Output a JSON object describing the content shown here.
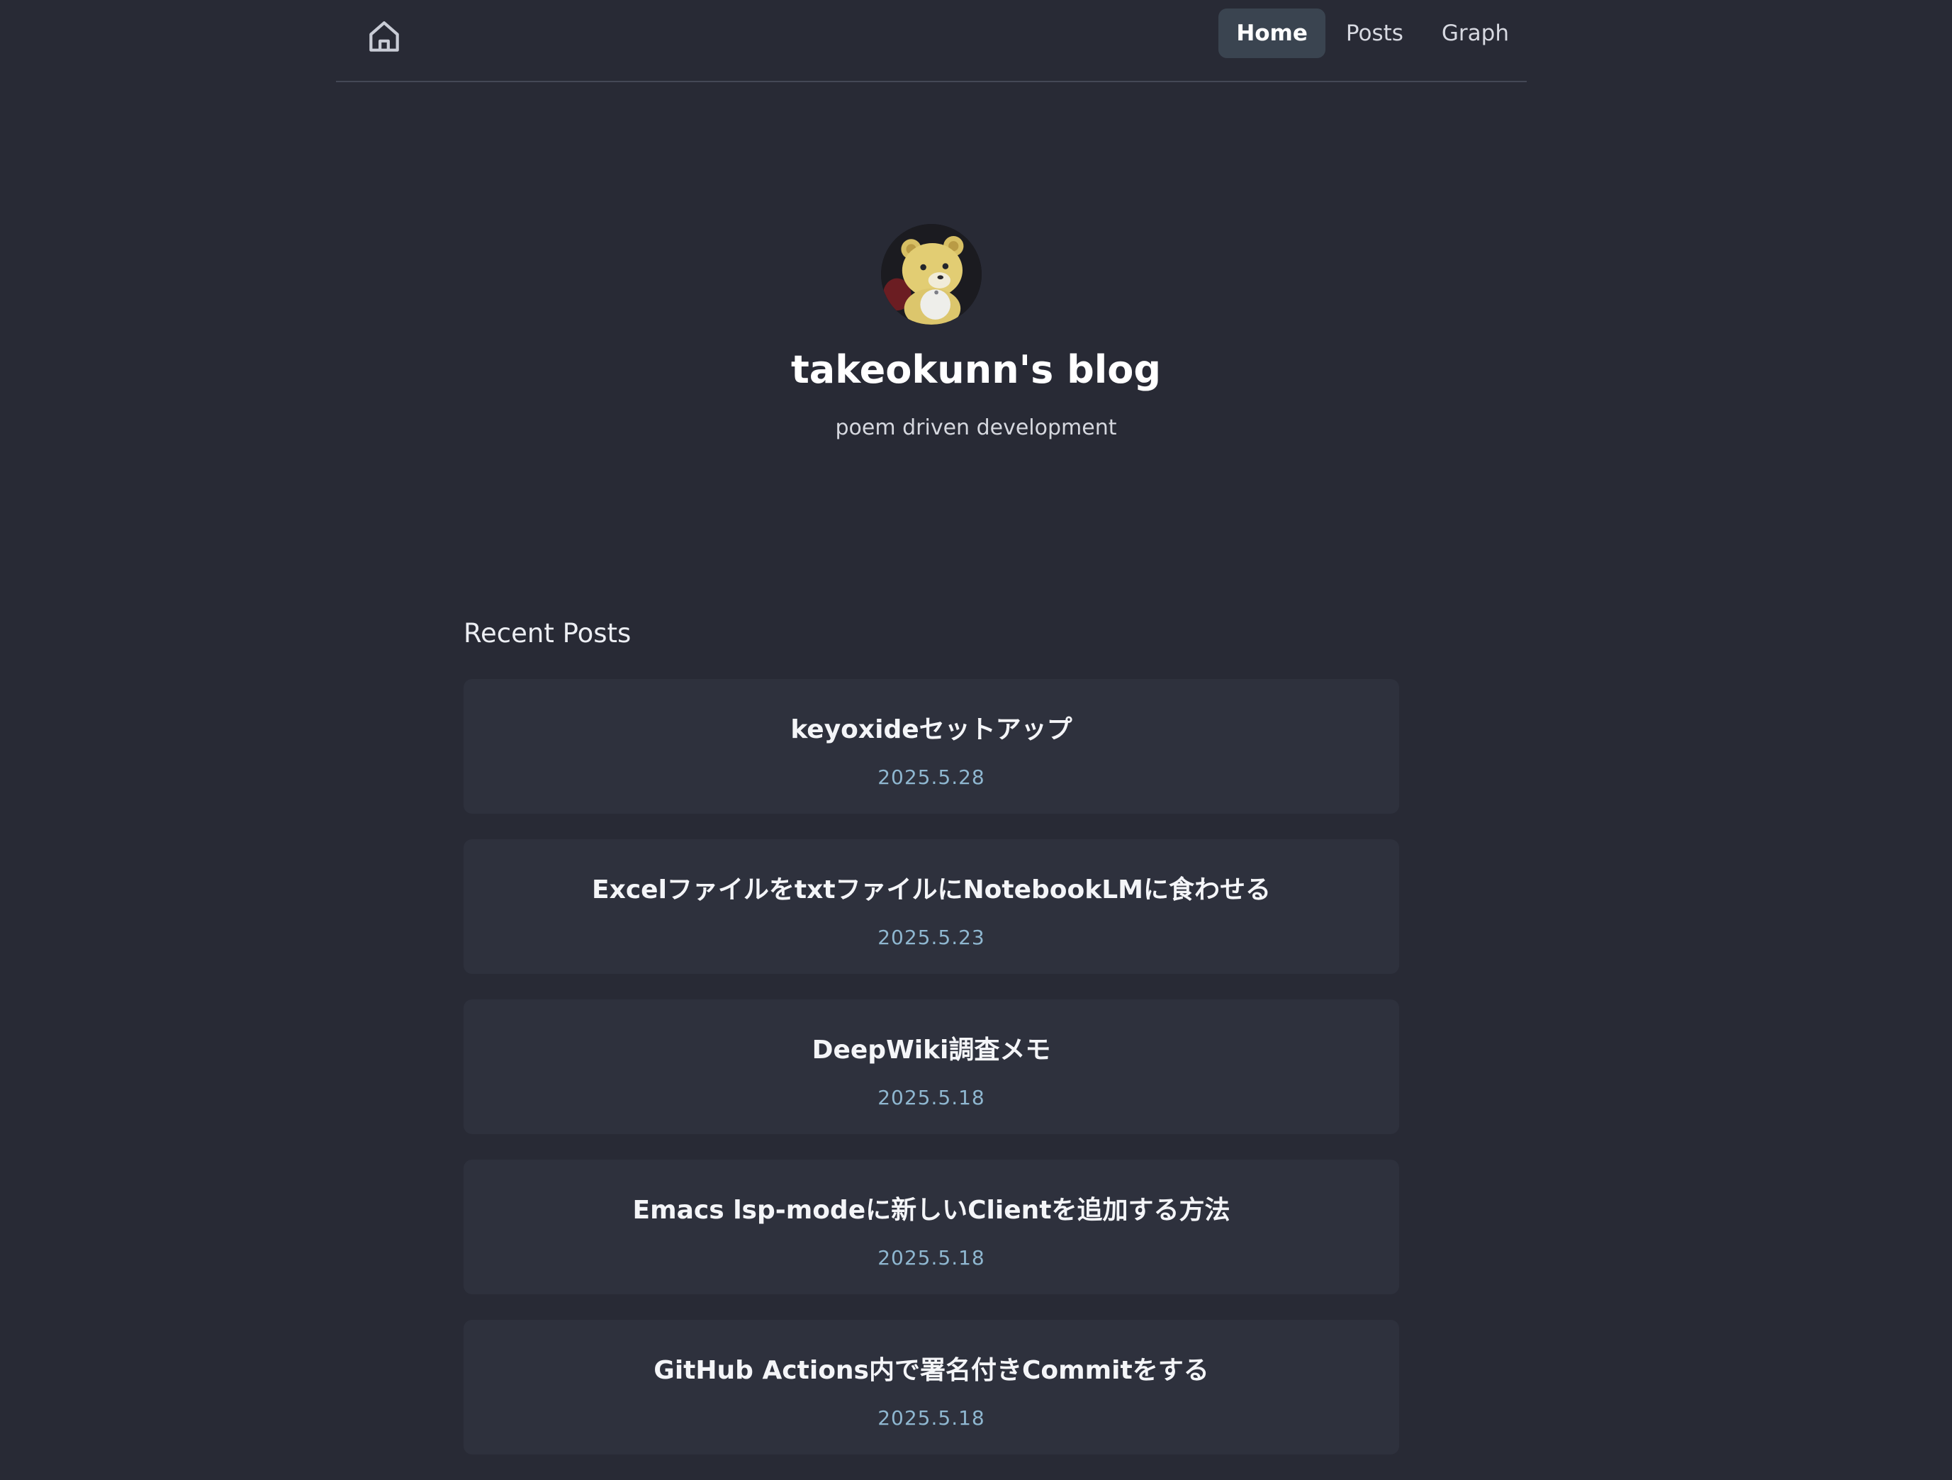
{
  "nav": {
    "home_icon": "home-icon",
    "links": [
      {
        "label": "Home",
        "active": true
      },
      {
        "label": "Posts",
        "active": false
      },
      {
        "label": "Graph",
        "active": false
      }
    ]
  },
  "profile": {
    "avatar": "bear-avatar",
    "title": "takeokunn's blog",
    "tagline": "poem driven development"
  },
  "recent_posts": {
    "heading": "Recent Posts",
    "items": [
      {
        "title": "keyoxideセットアップ",
        "date": "2025.5.28"
      },
      {
        "title": "ExcelファイルをtxtファイルにNotebookLMに食わせる",
        "date": "2025.5.23"
      },
      {
        "title": "DeepWiki調査メモ",
        "date": "2025.5.18"
      },
      {
        "title": "Emacs lsp-modeに新しいClientを追加する方法",
        "date": "2025.5.18"
      },
      {
        "title": "GitHub Actions内で署名付きCommitをする",
        "date": "2025.5.18"
      }
    ]
  },
  "colors": {
    "background": "#282a35",
    "card": "#2e313d",
    "active_nav": "#3a4450",
    "date": "#8fb7d0"
  }
}
